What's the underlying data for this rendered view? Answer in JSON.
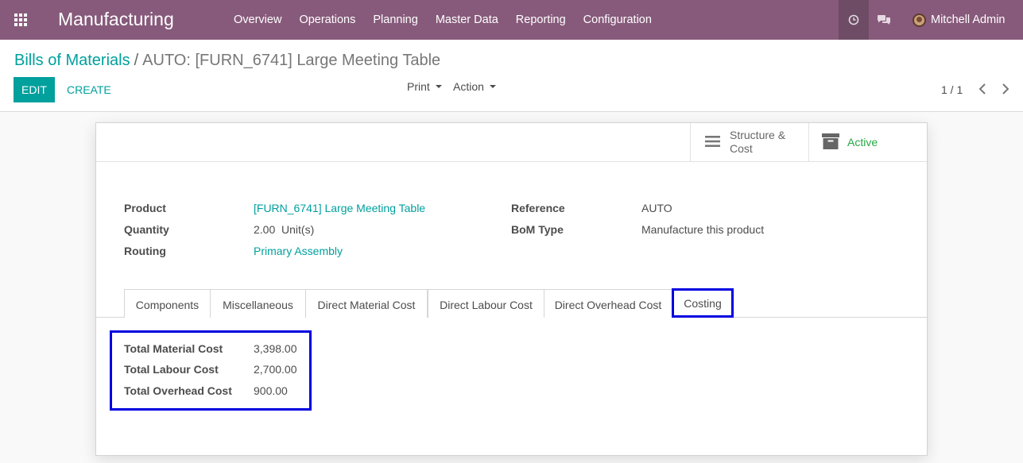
{
  "navbar": {
    "brand": "Manufacturing",
    "menu": [
      "Overview",
      "Operations",
      "Planning",
      "Master Data",
      "Reporting",
      "Configuration"
    ],
    "user": "Mitchell Admin"
  },
  "breadcrumb": {
    "parent": "Bills of Materials",
    "separator": "/",
    "current": "AUTO: [FURN_6741] Large Meeting Table"
  },
  "toolbar": {
    "edit_label": "EDIT",
    "create_label": "CREATE",
    "print_label": "Print",
    "action_label": "Action",
    "pager": "1 / 1"
  },
  "smart_buttons": {
    "structure_line1": "Structure &",
    "structure_line2": "Cost",
    "active_label": "Active"
  },
  "fields": {
    "product_label": "Product",
    "product_value": "[FURN_6741] Large Meeting Table",
    "quantity_label": "Quantity",
    "quantity_value": "2.00",
    "quantity_uom": "Unit(s)",
    "routing_label": "Routing",
    "routing_value": "Primary Assembly",
    "reference_label": "Reference",
    "reference_value": "AUTO",
    "bom_type_label": "BoM Type",
    "bom_type_value": "Manufacture this product"
  },
  "tabs": [
    "Components",
    "Miscellaneous",
    "Direct Material Cost",
    "Direct Labour Cost",
    "Direct Overhead Cost",
    "Costing"
  ],
  "active_tab": "Costing",
  "costing": {
    "material_label": "Total Material Cost",
    "material_value": "3,398.00",
    "labour_label": "Total Labour Cost",
    "labour_value": "2,700.00",
    "overhead_label": "Total Overhead Cost",
    "overhead_value": "900.00"
  },
  "colors": {
    "navbar": "#875a7b",
    "accent": "#00a09d",
    "highlight": "#0000e0",
    "active_green": "#28a745"
  }
}
